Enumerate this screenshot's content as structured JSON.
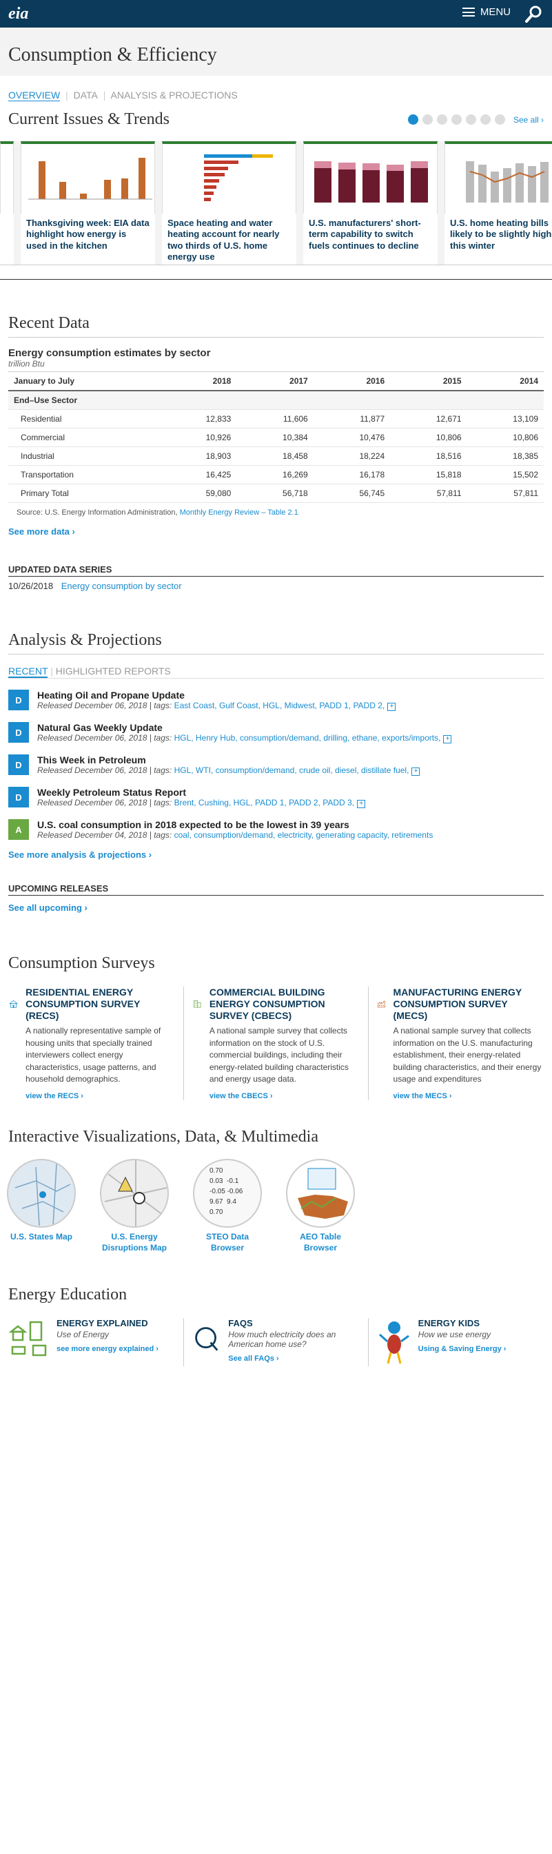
{
  "header": {
    "logo": "eia",
    "menu_label": "MENU"
  },
  "page_title": "Consumption & Efficiency",
  "tabs": [
    "OVERVIEW",
    "DATA",
    "ANALYSIS & PROJECTIONS"
  ],
  "current_issues": {
    "title": "Current Issues & Trends",
    "see_all": "See all ›",
    "cards": [
      {
        "title": "Thanksgiving week: EIA data highlight how energy is used in the kitchen"
      },
      {
        "title": "Space heating and water heating account for nearly two thirds of U.S. home energy use"
      },
      {
        "title": "U.S. manufacturers' short-term capability to switch fuels continues to decline"
      },
      {
        "title": "U.S. home heating bills likely to be slightly higher this winter"
      }
    ]
  },
  "recent_data": {
    "title": "Recent Data",
    "table_title": "Energy consumption estimates by sector",
    "table_unit": "trillion Btu",
    "columns": [
      "January to July",
      "2018",
      "2017",
      "2016",
      "2015",
      "2014"
    ],
    "group_label": "End–Use Sector",
    "rows": [
      {
        "label": "Residential",
        "v": [
          "12,833",
          "11,606",
          "11,877",
          "12,671",
          "13,109"
        ]
      },
      {
        "label": "Commercial",
        "v": [
          "10,926",
          "10,384",
          "10,476",
          "10,806",
          "10,806"
        ]
      },
      {
        "label": "Industrial",
        "v": [
          "18,903",
          "18,458",
          "18,224",
          "18,516",
          "18,385"
        ]
      },
      {
        "label": "Transportation",
        "v": [
          "16,425",
          "16,269",
          "16,178",
          "15,818",
          "15,502"
        ]
      },
      {
        "label": "Primary Total",
        "v": [
          "59,080",
          "56,718",
          "56,745",
          "57,811",
          "57,811"
        ]
      }
    ],
    "source_text": "Source: U.S. Energy Information Administration,",
    "source_link": "Monthly Energy Review – Table 2.1",
    "see_more": "See more data ›"
  },
  "updated_series": {
    "title": "UPDATED DATA SERIES",
    "date": "10/26/2018",
    "link": "Energy consumption by sector"
  },
  "analysis": {
    "title": "Analysis & Projections",
    "tab_recent": "RECENT",
    "tab_highlighted": "HIGHLIGHTED REPORTS",
    "items": [
      {
        "badge": "D",
        "title": "Heating Oil and Propane Update",
        "released": "Released December 06, 2018 | tags:",
        "tags": "East Coast, Gulf Coast, HGL, Midwest, PADD 1, PADD 2,"
      },
      {
        "badge": "D",
        "title": "Natural Gas Weekly Update",
        "released": "Released December 06, 2018 | tags:",
        "tags": "HGL, Henry Hub, consumption/demand, drilling, ethane, exports/imports,"
      },
      {
        "badge": "D",
        "title": "This Week in Petroleum",
        "released": "Released December 06, 2018 | tags:",
        "tags": "HGL, WTI, consumption/demand, crude oil, diesel, distillate fuel,"
      },
      {
        "badge": "D",
        "title": "Weekly Petroleum Status Report",
        "released": "Released December 06, 2018 | tags:",
        "tags": "Brent, Cushing, HGL, PADD 1, PADD 2, PADD 3,"
      },
      {
        "badge": "A",
        "title": "U.S. coal consumption in 2018 expected to be the lowest in 39 years",
        "released": "Released December 04, 2018 | tags:",
        "tags": "coal, consumption/demand, electricity, generating capacity, retirements"
      }
    ],
    "see_more": "See more analysis & projections ›",
    "upcoming_title": "UPCOMING RELEASES",
    "see_upcoming": "See all upcoming ›"
  },
  "surveys": {
    "title": "Consumption Surveys",
    "items": [
      {
        "title": "RESIDENTIAL ENERGY CONSUMPTION SURVEY (RECS)",
        "desc": "A nationally representative sample of housing units that specially trained interviewers collect energy characteristics, usage patterns, and household demographics.",
        "link": "view the RECS ›"
      },
      {
        "title": "COMMERCIAL BUILDING ENERGY CONSUMPTION SURVEY (CBECS)",
        "desc": "A national sample survey that collects information on the stock of U.S. commercial buildings, including their energy-related building characteristics and energy usage data.",
        "link": "view the CBECS ›"
      },
      {
        "title": "MANUFACTURING ENERGY CONSUMPTION SURVEY (MECS)",
        "desc": "A national sample survey that collects information on the U.S. manufacturing establishment, their energy-related building characteristics, and their energy usage and expenditures",
        "link": "view the MECS ›"
      }
    ]
  },
  "viz": {
    "title": "Interactive Visualizations, Data, & Multimedia",
    "items": [
      {
        "label": "U.S. States Map"
      },
      {
        "label": "U.S. Energy Disruptions Map"
      },
      {
        "label": "STEO Data Browser"
      },
      {
        "label": "AEO Table Browser"
      }
    ],
    "steo_values": [
      "0.70",
      "0.03",
      "-0.1",
      "-0.05",
      "-0.06",
      "9.67",
      "9.4",
      "0.70"
    ]
  },
  "education": {
    "title": "Energy Education",
    "items": [
      {
        "title": "ENERGY EXPLAINED",
        "sub": "Use of Energy",
        "link": "see more energy explained ›"
      },
      {
        "title": "FAQS",
        "sub": "How much electricity does an American home use?",
        "link": "See all FAQs ›"
      },
      {
        "title": "ENERGY KIDS",
        "sub": "How we use energy",
        "link": "Using & Saving Energy ›"
      }
    ]
  },
  "colors": {
    "navy": "#0b3a5a",
    "link": "#1a8ccf",
    "green": "#2f7d32",
    "analysis_badge": "#6aa842"
  }
}
